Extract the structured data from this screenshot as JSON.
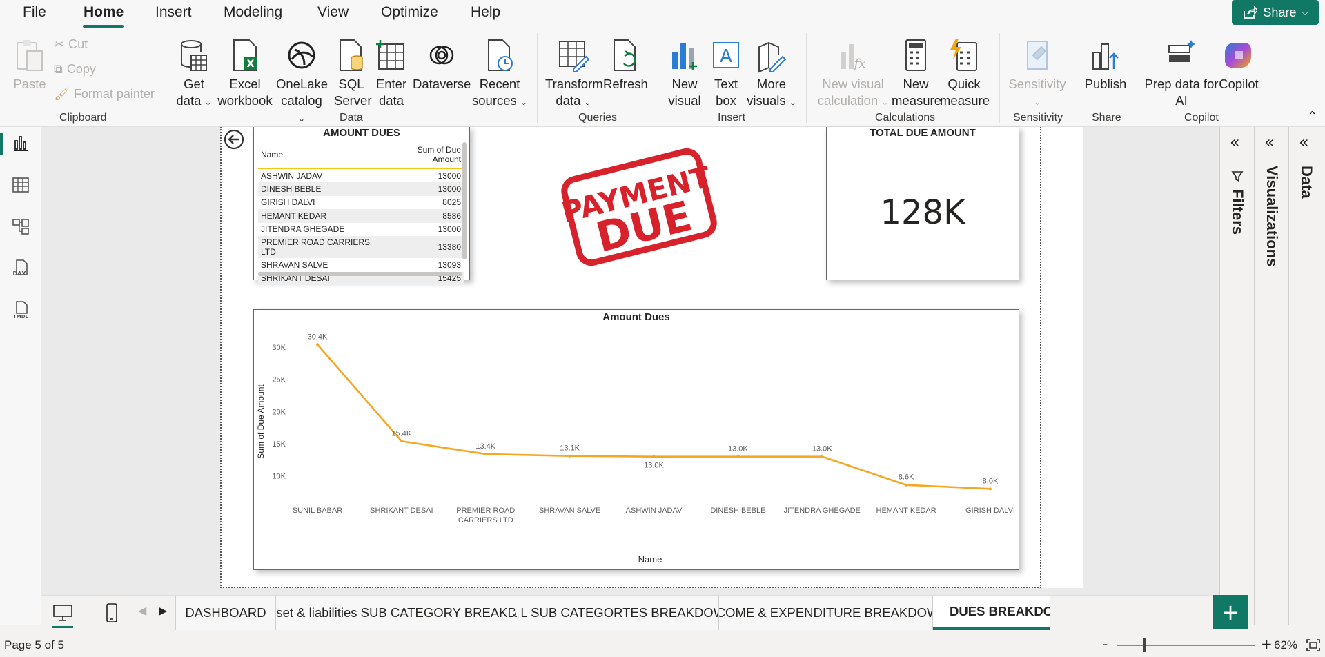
{
  "menu": {
    "items": [
      "File",
      "Home",
      "Insert",
      "Modeling",
      "View",
      "Optimize",
      "Help"
    ],
    "share_label": "Share"
  },
  "ribbon": {
    "clipboard": {
      "paste": "Paste",
      "cut": "Cut",
      "copy": "Copy",
      "format_painter": "Format painter",
      "label": "Clipboard"
    },
    "data": {
      "get_data": [
        "Get",
        "data"
      ],
      "excel": [
        "Excel",
        "workbook"
      ],
      "onelake": [
        "OneLake",
        "catalog"
      ],
      "sql": [
        "SQL",
        "Server"
      ],
      "enter": [
        "Enter",
        "data"
      ],
      "dataverse": "Dataverse",
      "recent": [
        "Recent",
        "sources"
      ],
      "label": "Data"
    },
    "queries": {
      "transform": [
        "Transform",
        "data"
      ],
      "refresh": "Refresh",
      "label": "Queries"
    },
    "insert": {
      "new_visual": [
        "New",
        "visual"
      ],
      "text_box": [
        "Text",
        "box"
      ],
      "more_visuals": [
        "More",
        "visuals"
      ],
      "label": "Insert"
    },
    "calculations": {
      "new_visual_calc": [
        "New visual",
        "calculation"
      ],
      "new_measure": [
        "New",
        "measure"
      ],
      "quick_measure": [
        "Quick",
        "measure"
      ],
      "label": "Calculations"
    },
    "sensitivity": {
      "btn": "Sensitivity",
      "label": "Sensitivity"
    },
    "share": {
      "publish": "Publish",
      "label": "Share"
    },
    "copilot": {
      "prep": [
        "Prep data for",
        "AI"
      ],
      "copilot": "Copilot",
      "label": "Copilot"
    }
  },
  "report": {
    "table_visual": {
      "title": "AMOUNT DUES",
      "headers": [
        "Name",
        "Sum of Due Amount"
      ],
      "rows": [
        [
          "ASHWIN JADAV",
          "13000"
        ],
        [
          "DINESH BEBLE",
          "13000"
        ],
        [
          "GIRISH DALVI",
          "8025"
        ],
        [
          "HEMANT KEDAR",
          "8586"
        ],
        [
          "JITENDRA GHEGADE",
          "13000"
        ],
        [
          "PREMIER ROAD CARRIERS LTD",
          "13380"
        ],
        [
          "SHRAVAN SALVE",
          "13093"
        ],
        [
          "SHRIKANT DESAI",
          "15425"
        ]
      ]
    },
    "stamp": {
      "line1": "PAYMENT",
      "line2": "DUE"
    },
    "card_visual": {
      "title": "TOTAL DUE AMOUNT",
      "value": "128K"
    }
  },
  "chart_data": {
    "type": "line",
    "title": "Amount Dues",
    "xlabel": "Name",
    "ylabel": "Sum of Due Amount",
    "categories": [
      "SUNIL BABAR",
      "SHRIKANT DESAI",
      "PREMIER ROAD CARRIERS LTD",
      "SHRAVAN SALVE",
      "ASHWIN JADAV",
      "DINESH BEBLE",
      "JITENDRA GHEGADE",
      "HEMANT KEDAR",
      "GIRISH DALVI"
    ],
    "values": [
      30400,
      15400,
      13400,
      13100,
      13000,
      13000,
      13000,
      8600,
      8000
    ],
    "data_labels": [
      "30.4K",
      "15.4K",
      "13.4K",
      "13.1K",
      "13.0K",
      "13.0K",
      "13.0K",
      "8.6K",
      "8.0K"
    ],
    "yticks": [
      10000,
      15000,
      20000,
      25000,
      30000
    ],
    "ytick_labels": [
      "10K",
      "15K",
      "20K",
      "25K",
      "30K"
    ],
    "ylim": [
      7500,
      31500
    ],
    "color": "#f5a623"
  },
  "panes": {
    "filters": "Filters",
    "visualizations": "Visualizations",
    "data": "Data"
  },
  "tabs": [
    "DASHBOARD",
    "Asset & liabilities SUB CATEGORY BREAKD...",
    "A & L SUB CATEGORTES BREAKDOWN",
    "INCOME & EXPENDITURE BREAKDOWN",
    "DUES BREAKDOWN"
  ],
  "status": {
    "page": "Page 5 of 5",
    "zoom": "62%"
  },
  "colors": {
    "accent": "#117865",
    "stamp_red": "#d7222b",
    "line": "#f5a623"
  }
}
